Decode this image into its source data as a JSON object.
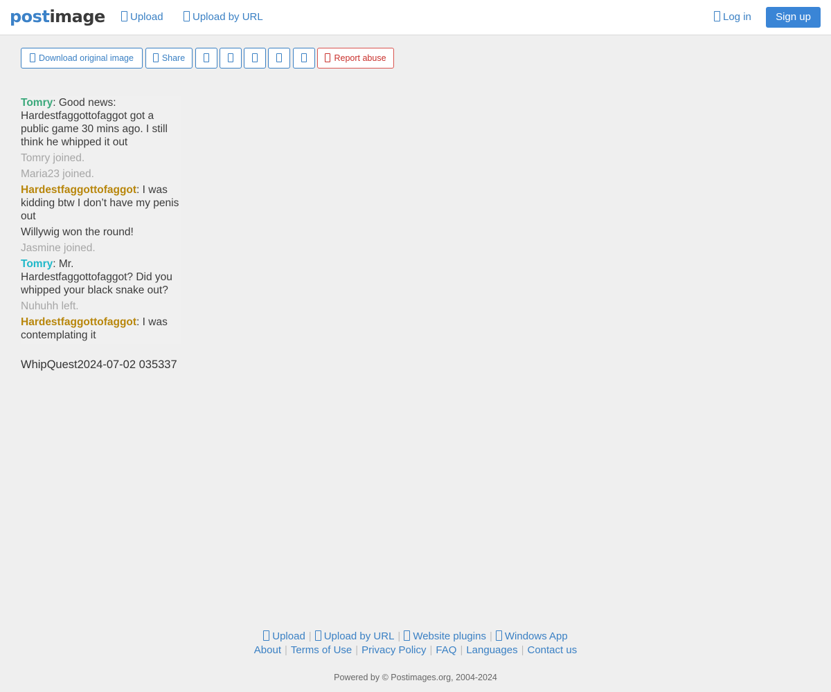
{
  "navbar": {
    "logo_part1": "post",
    "logo_part2": "image",
    "upload": "Upload",
    "upload_by_url": "Upload by URL",
    "login": "Log in",
    "signup": "Sign up"
  },
  "toolbar": {
    "download": "Download original image",
    "share": "Share",
    "report": "Report abuse"
  },
  "chat": {
    "m1_name": "Tomry",
    "m1_text": ": Good news: Hardestfaggottofaggot got a public game 30 mins ago. I still think he whipped it out",
    "m2": "Tomry joined.",
    "m3": "Maria23 joined.",
    "m4_name": "Hardestfaggottofaggot",
    "m4_text": ": I was kidding btw I don’t have my penis out",
    "m5": "Willywig won the round!",
    "m6": "Jasmine joined.",
    "m7_name": "Tomry",
    "m7_text": ": Mr. Hardestfaggottofaggot? Did you whipped your black snake out?",
    "m8": "Nuhuhh left.",
    "m9_name": "Hardestfaggottofaggot",
    "m9_text": ": I was contemplating it"
  },
  "image_caption": "WhipQuest2024-07-02 035337",
  "footer": {
    "upload": "Upload",
    "upload_by_url": "Upload by URL",
    "website_plugins": "Website plugins",
    "windows_app": "Windows App",
    "about": "About",
    "terms": "Terms of Use",
    "privacy": "Privacy Policy",
    "faq": "FAQ",
    "languages": "Languages",
    "contact": "Contact us",
    "powered": "Powered by © Postimages.org, 2004-2024"
  },
  "colors": {
    "link": "#3a80c4",
    "brand_blue": "#3c82c8",
    "signup_bg": "#3a85d6",
    "danger": "#c9302c",
    "chat_name_green": "#3aa87a",
    "chat_name_gold": "#b8860b",
    "chat_name_cyan": "#1fb8c9"
  }
}
